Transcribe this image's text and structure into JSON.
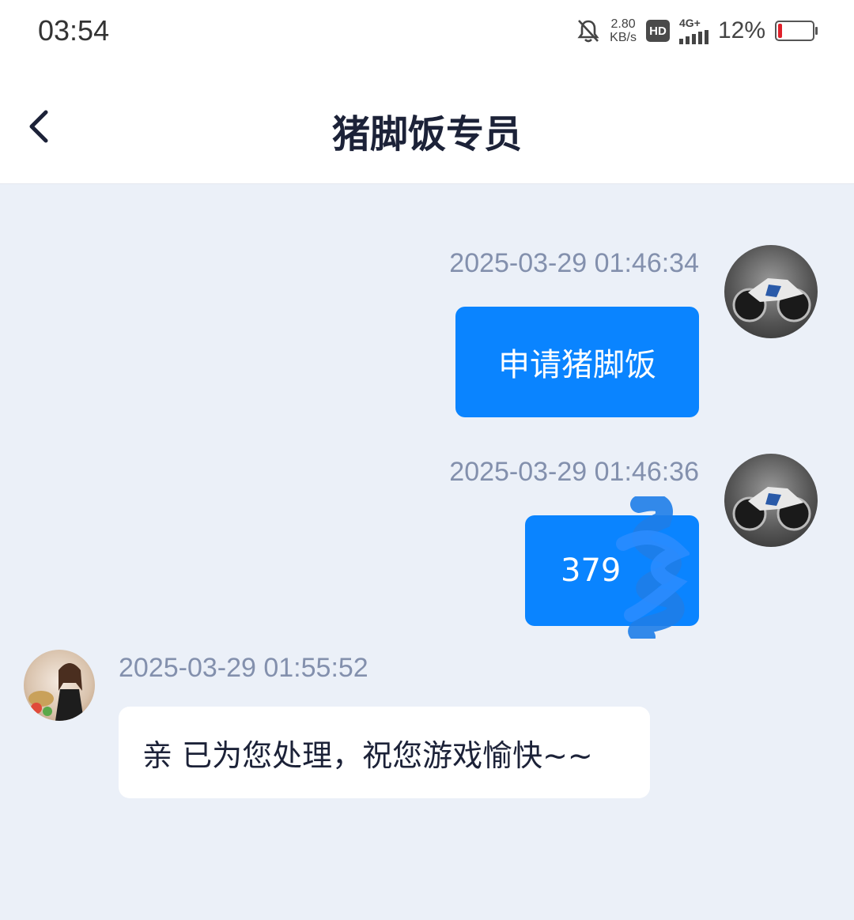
{
  "status_bar": {
    "time": "03:54",
    "speed_value": "2.80",
    "speed_unit": "KB/s",
    "hd": "HD",
    "network": "4G+",
    "battery_percent": "12%",
    "battery_level": 0.12,
    "icons": [
      "mute-bell-icon",
      "hd-icon",
      "signal-icon",
      "battery-icon"
    ]
  },
  "header": {
    "title": "猪脚饭专员",
    "back_icon": "chevron-left-icon"
  },
  "messages": [
    {
      "from": "me",
      "timestamp": "2025-03-29 01:46:34",
      "text": "申请猪脚饭",
      "avatar": "motorcycle-avatar"
    },
    {
      "from": "me",
      "timestamp": "2025-03-29 01:46:36",
      "text": "379",
      "redacted": true,
      "avatar": "motorcycle-avatar"
    },
    {
      "from": "agent",
      "timestamp": "2025-03-29 01:55:52",
      "text": "亲 已为您处理，祝您游戏愉快~~",
      "avatar": "agent-avatar"
    }
  ],
  "colors": {
    "background": "#ebf0f8",
    "outgoing_bubble": "#0a84ff",
    "incoming_bubble": "#ffffff",
    "timestamp": "#8390ad",
    "title": "#1c2238"
  }
}
